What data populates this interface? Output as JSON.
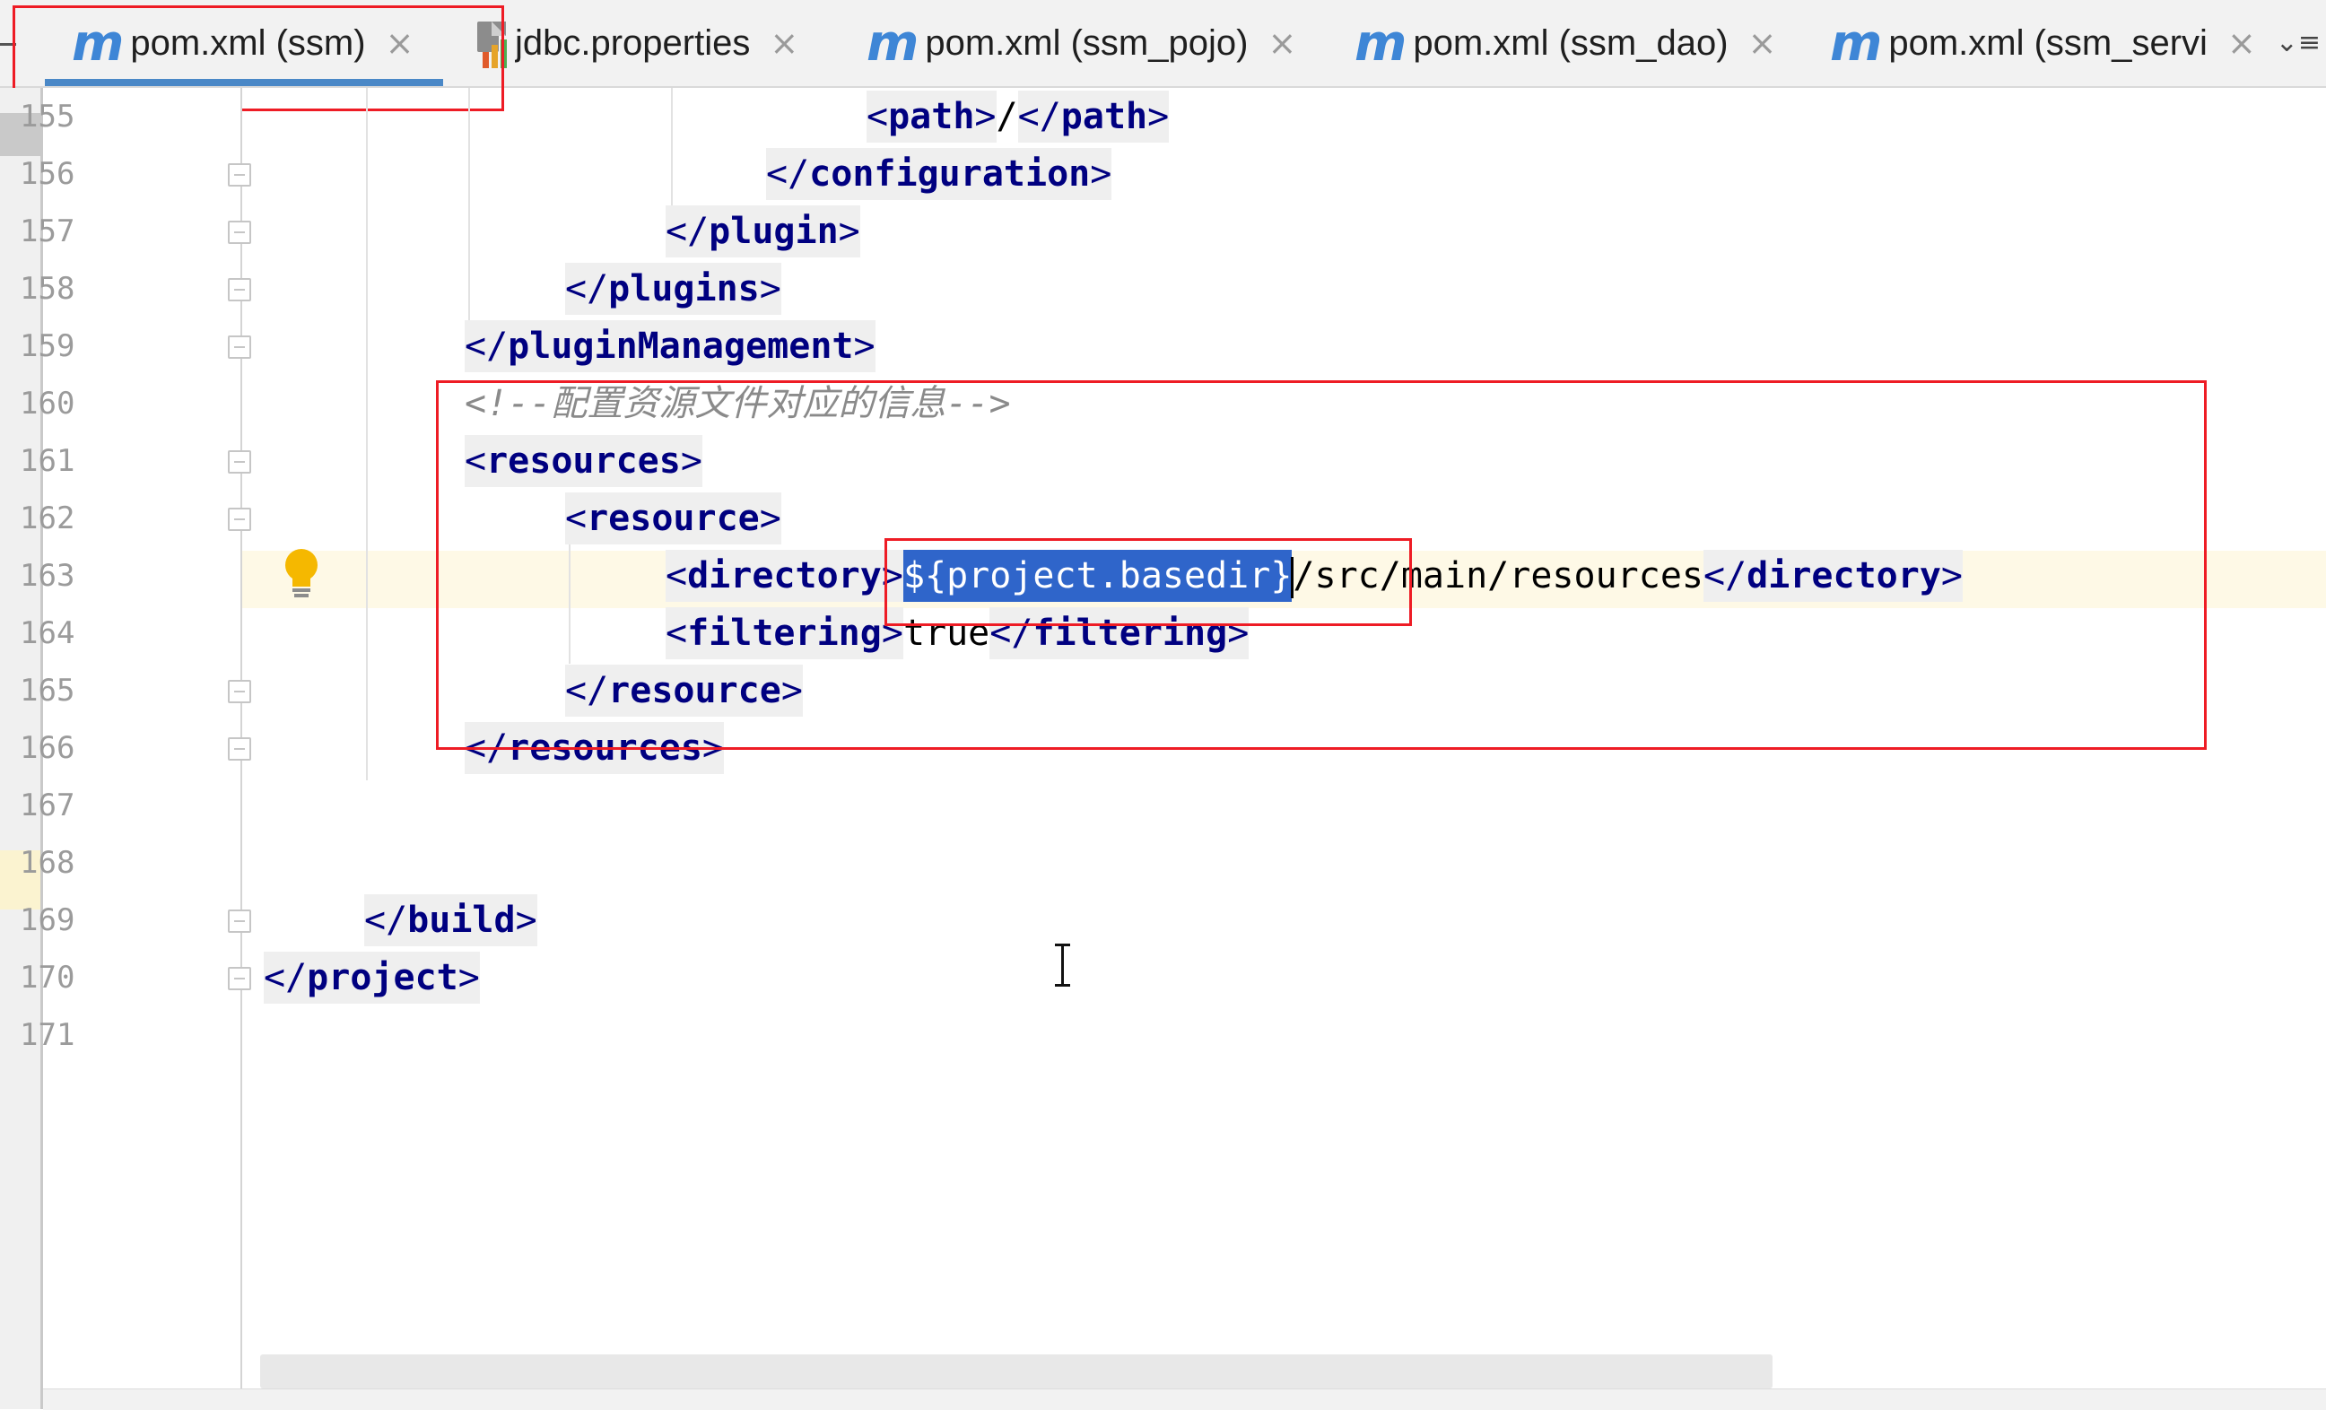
{
  "tabs": [
    {
      "label": "pom.xml (ssm)",
      "icon": "maven-icon",
      "active": true
    },
    {
      "label": "jdbc.properties",
      "icon": "properties-file-icon",
      "active": false
    },
    {
      "label": "pom.xml (ssm_pojo)",
      "icon": "maven-icon",
      "active": false
    },
    {
      "label": "pom.xml (ssm_dao)",
      "icon": "maven-icon",
      "active": false
    },
    {
      "label": "pom.xml (ssm_servi",
      "icon": "maven-icon",
      "active": false
    }
  ],
  "tab_icon_glyph": "m",
  "close_glyph": "×",
  "overflow_glyph": "⌄≡",
  "editor": {
    "caret_line": 163,
    "selected_text": "${project.basedir}",
    "lines": [
      {
        "n": "155",
        "pre": "",
        "open": "path",
        "text": "/",
        "close": "path"
      },
      {
        "n": "156",
        "closing_tag": "configuration"
      },
      {
        "n": "157",
        "closing_tag": "plugin"
      },
      {
        "n": "158",
        "closing_tag": "plugins"
      },
      {
        "n": "159",
        "closing_tag": "pluginManagement"
      },
      {
        "n": "160",
        "comment": "<!--配置资源文件对应的信息-->"
      },
      {
        "n": "161",
        "opening_tag": "resources"
      },
      {
        "n": "162",
        "opening_tag": "resource"
      },
      {
        "n": "163",
        "open": "directory",
        "selected": "${project.basedir}",
        "text": "/src/main/resources",
        "close": "directory"
      },
      {
        "n": "164",
        "open": "filtering",
        "text": "true",
        "close": "filtering"
      },
      {
        "n": "165",
        "closing_tag": "resource"
      },
      {
        "n": "166",
        "closing_tag": "resources"
      },
      {
        "n": "167"
      },
      {
        "n": "168"
      },
      {
        "n": "169",
        "closing_tag": "build"
      },
      {
        "n": "170",
        "closing_tag": "project"
      },
      {
        "n": "171"
      }
    ]
  },
  "colors": {
    "tag": "#000080",
    "comment": "#8a8a8a",
    "selection": "#2f65ca",
    "annotation": "#ee1c25",
    "tab_icon": "#3e86d6"
  }
}
